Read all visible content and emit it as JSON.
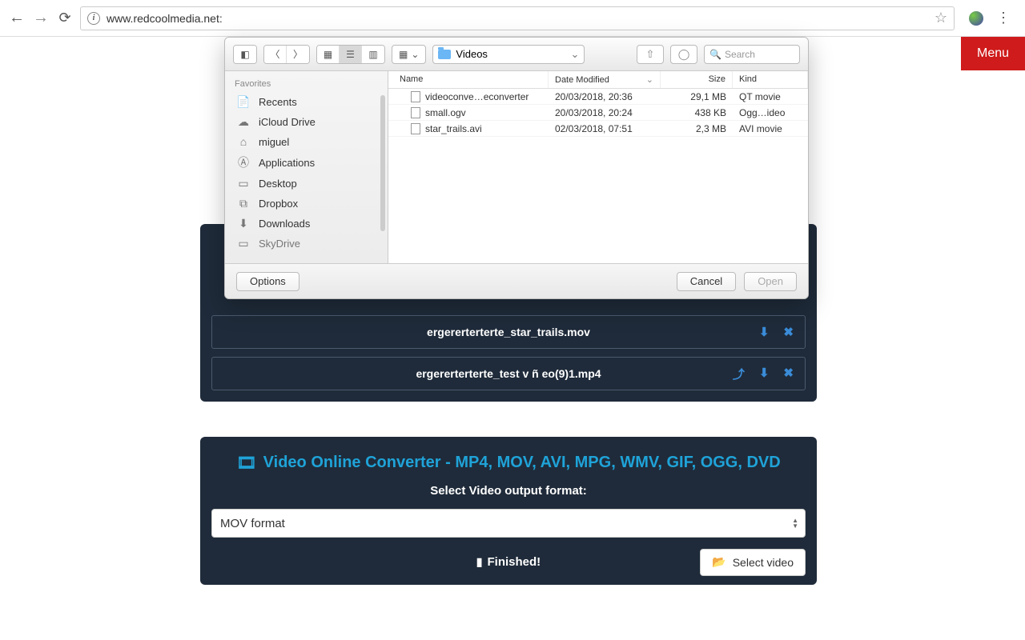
{
  "browser": {
    "url": "www.redcoolmedia.net:"
  },
  "menu": {
    "label": "Menu"
  },
  "fileList": {
    "rows": [
      {
        "name": "ergererterterte_star_trails.mov",
        "icons": [
          "download",
          "close"
        ]
      },
      {
        "name": "ergererterterte_test v ñ eo(9)1.mp4",
        "icons": [
          "share",
          "download",
          "close"
        ]
      }
    ]
  },
  "converter": {
    "title": "Video Online Converter - MP4, MOV, AVI, MPG, WMV, GIF, OGG, DVD",
    "subtitle": "Select Video output format:",
    "selected": "MOV format",
    "finished": "Finished!",
    "selectVideo": "Select video"
  },
  "dialog": {
    "folder": "Videos",
    "searchPlaceholder": "Search",
    "favoritesHeader": "Favorites",
    "favorites": [
      {
        "icon": "📄",
        "label": "Recents"
      },
      {
        "icon": "☁",
        "label": "iCloud Drive"
      },
      {
        "icon": "⌂",
        "label": "miguel"
      },
      {
        "icon": "Ⓐ",
        "label": "Applications"
      },
      {
        "icon": "▭",
        "label": "Desktop"
      },
      {
        "icon": "⧉",
        "label": "Dropbox"
      },
      {
        "icon": "⬇",
        "label": "Downloads"
      },
      {
        "icon": "▭",
        "label": "SkyDrive"
      }
    ],
    "columns": {
      "name": "Name",
      "date": "Date Modified",
      "size": "Size",
      "kind": "Kind"
    },
    "files": [
      {
        "name": "videoconve…econverter",
        "date": "20/03/2018, 20:36",
        "size": "29,1 MB",
        "kind": "QT movie"
      },
      {
        "name": "small.ogv",
        "date": "20/03/2018, 20:24",
        "size": "438 KB",
        "kind": "Ogg…ideo"
      },
      {
        "name": "star_trails.avi",
        "date": "02/03/2018, 07:51",
        "size": "2,3 MB",
        "kind": "AVI movie"
      }
    ],
    "options": "Options",
    "cancel": "Cancel",
    "open": "Open"
  }
}
